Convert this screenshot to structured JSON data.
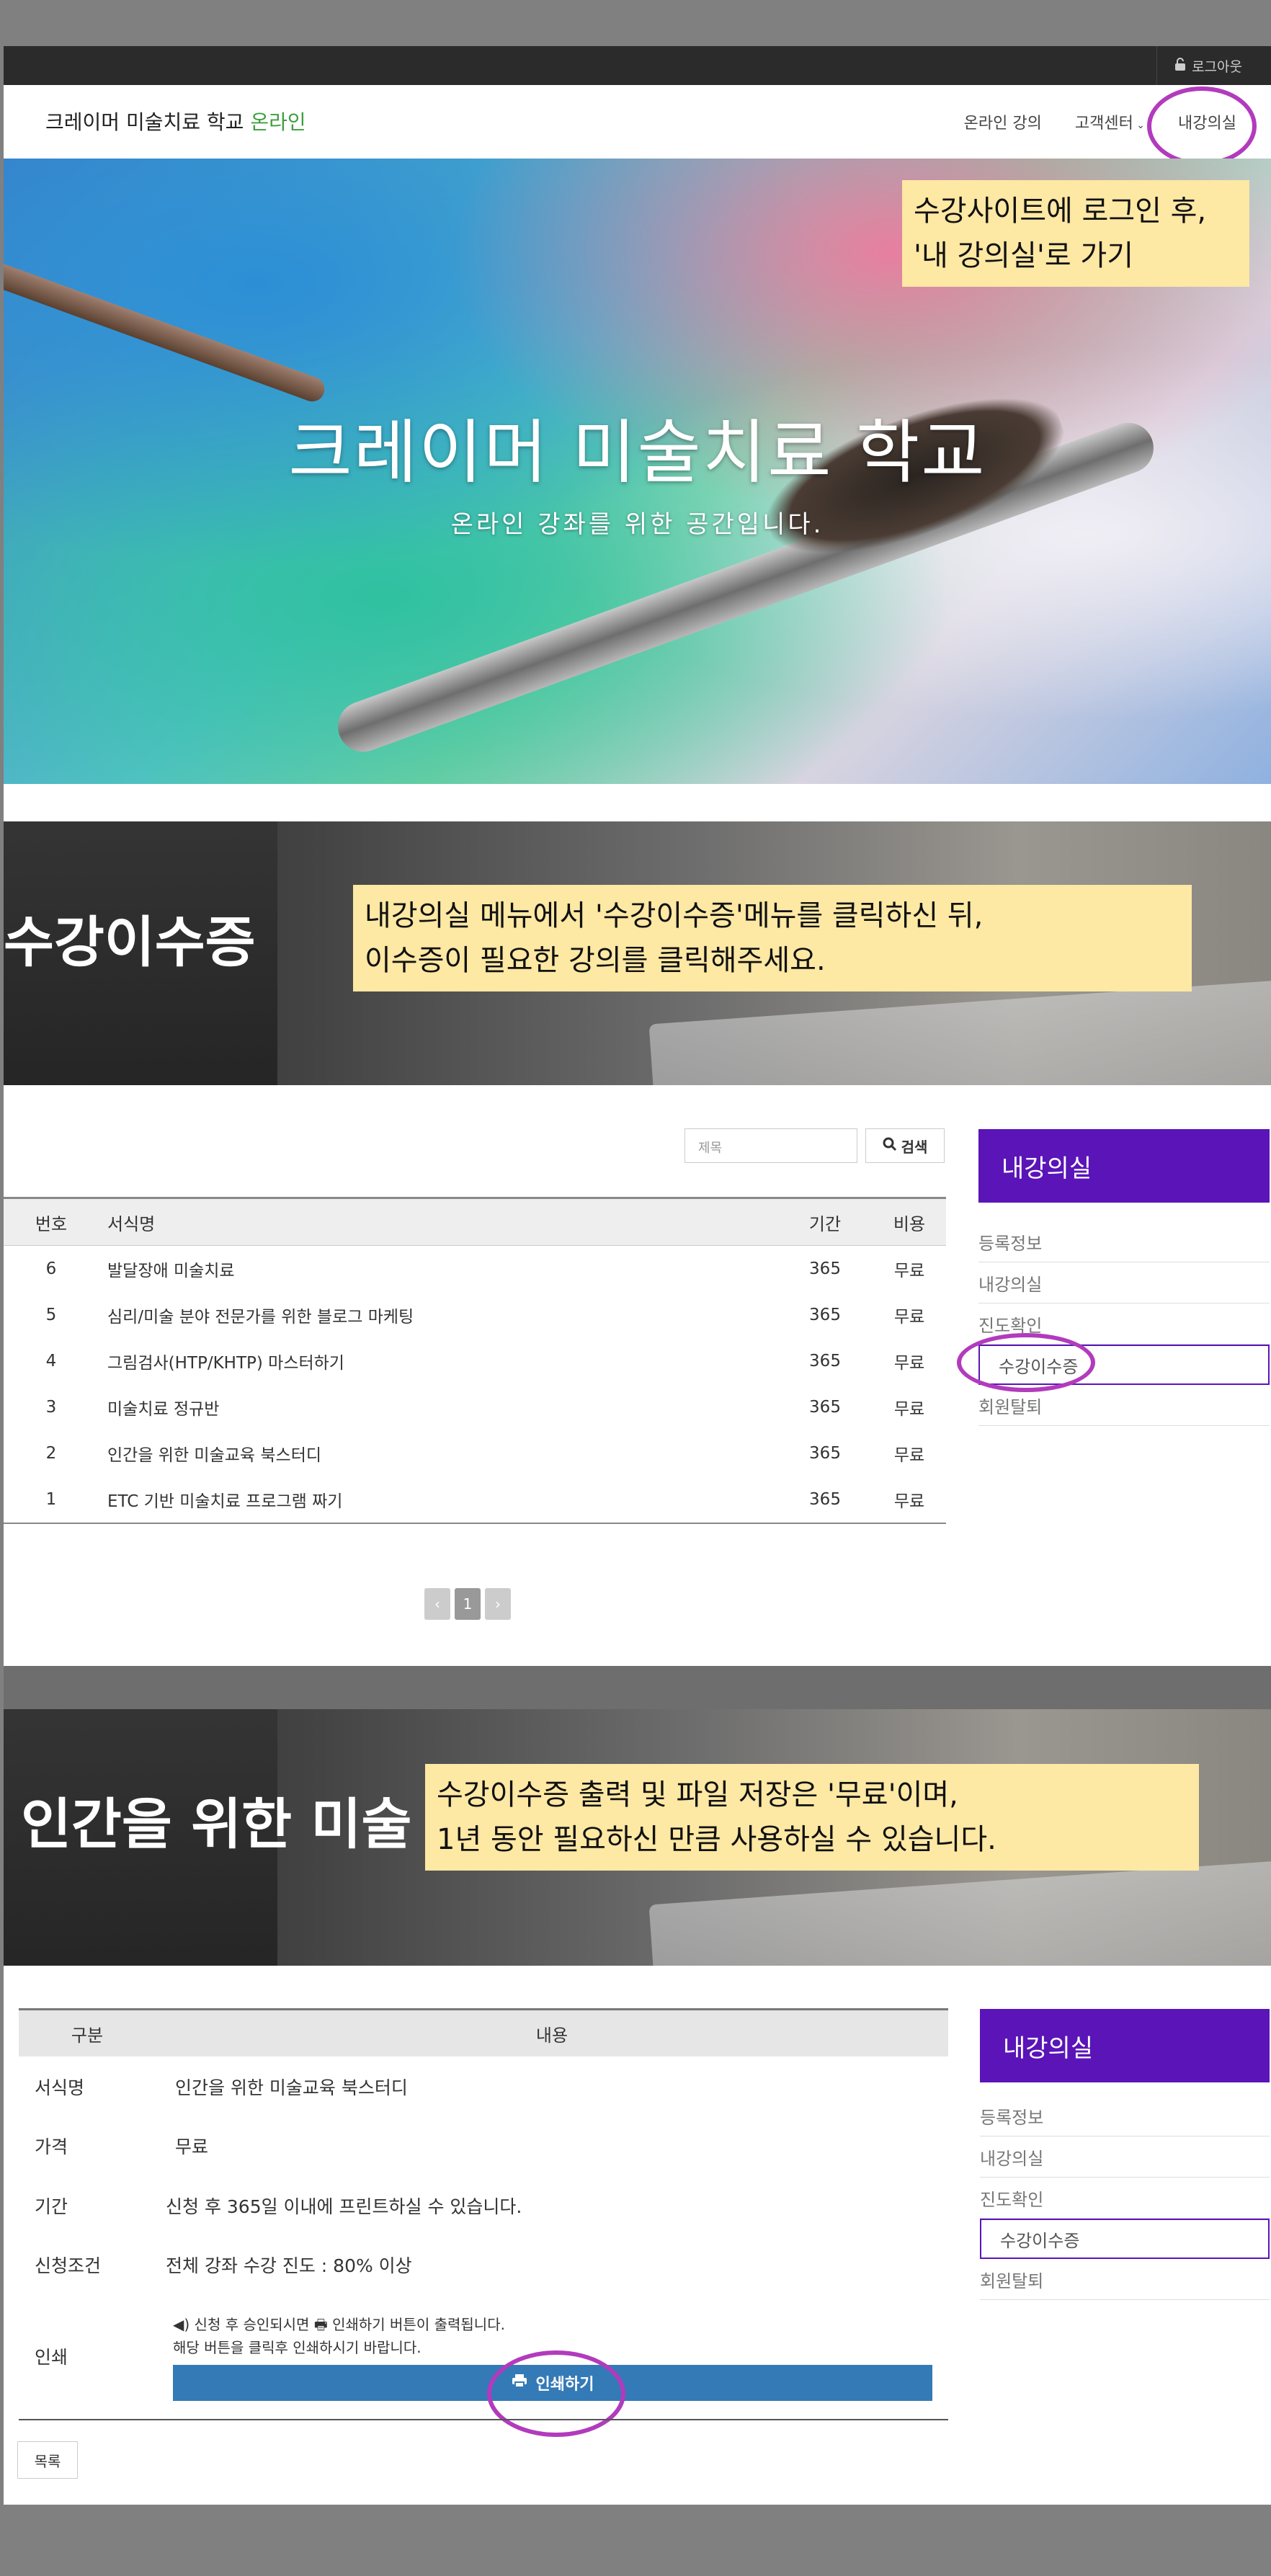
{
  "header": {
    "logout": "로그아웃",
    "brand_main": "크레이머 미술치료 학교",
    "brand_accent": "온라인",
    "nav": [
      "온라인 강의",
      "고객센터",
      "내강의실"
    ]
  },
  "hero": {
    "title": "크레이머 미술치료 학교",
    "subtitle": "온라인 강좌를 위한 공간입니다."
  },
  "notes": {
    "login": [
      "수강사이트에 로그인 후,",
      "'내 강의실'로 가기"
    ],
    "menu": [
      "내강의실 메뉴에서 '수강이수증'메뉴를 클릭하신 뒤,",
      "이수증이 필요한 강의를 클릭해주세요."
    ],
    "print": [
      "수강이수증 출력 및 파일 저장은 '무료'이며,",
      "1년 동안 필요하신 만큼 사용하실 수 있습니다."
    ]
  },
  "banner1": {
    "title": "수강이수증"
  },
  "list": {
    "search_placeholder": "제목",
    "search_button": "검색",
    "headers": [
      "번호",
      "서식명",
      "기간",
      "비용"
    ],
    "rows": [
      {
        "no": "6",
        "name": "발달장애 미술치료",
        "period": "365",
        "cost": "무료"
      },
      {
        "no": "5",
        "name": "심리/미술 분야 전문가를 위한 블로그 마케팅",
        "period": "365",
        "cost": "무료"
      },
      {
        "no": "4",
        "name": "그림검사(HTP/KHTP) 마스터하기",
        "period": "365",
        "cost": "무료"
      },
      {
        "no": "3",
        "name": "미술치료 정규반",
        "period": "365",
        "cost": "무료"
      },
      {
        "no": "2",
        "name": "인간을 위한 미술교육 북스터디",
        "period": "365",
        "cost": "무료"
      },
      {
        "no": "1",
        "name": "ETC 기반 미술치료 프로그램 짜기",
        "period": "365",
        "cost": "무료"
      }
    ],
    "pager": {
      "prev": "‹",
      "current": "1",
      "next": "›"
    }
  },
  "sidebar": {
    "title": "내강의실",
    "items": [
      "등록정보",
      "내강의실",
      "진도확인",
      "수강이수증",
      "회원탈퇴"
    ]
  },
  "banner2": {
    "title": "인간을 위한 미술"
  },
  "detail": {
    "headers": [
      "구분",
      "내용"
    ],
    "rows": [
      {
        "label": "서식명",
        "value": "인간을 위한 미술교육 북스터디"
      },
      {
        "label": "가격",
        "value": "무료"
      },
      {
        "label": "기간",
        "value": "신청 후 365일 이내에 프린트하실 수 있습니다."
      },
      {
        "label": "신청조건",
        "value": "전체 강좌 수강 진도 : 80% 이상"
      }
    ],
    "print_label": "인쇄",
    "print_info1_a": "신청 후 승인되시면",
    "print_info1_b": "인쇄하기 버튼이 출력됩니다.",
    "print_info2": "해당 버튼을 클릭후 인쇄하시기 바랍니다.",
    "print_button": "인쇄하기",
    "list_button": "목록"
  },
  "colors": {
    "accent": "#5a14b8",
    "highlight_circle": "#b23bbd",
    "note_bg": "#fde8a4",
    "print_button": "#337ab7"
  }
}
